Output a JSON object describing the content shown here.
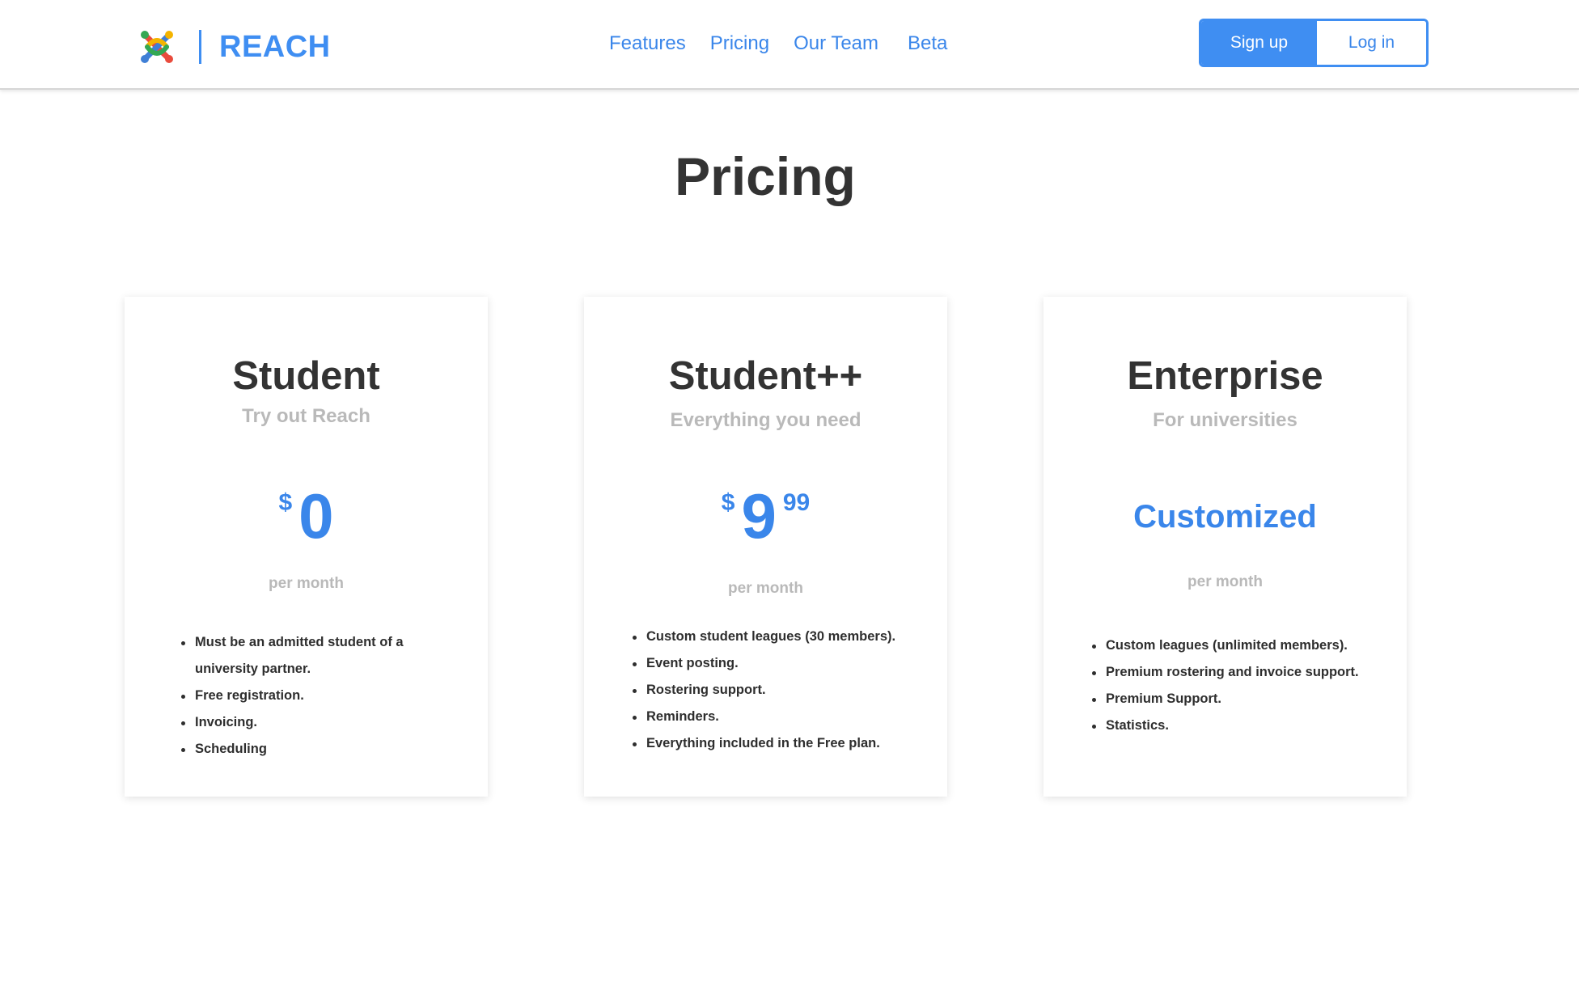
{
  "header": {
    "brand": "REACH",
    "nav": [
      "Features",
      "Pricing",
      "Our Team",
      "Beta"
    ],
    "signup_label": "Sign up",
    "login_label": "Log in"
  },
  "title": "Pricing",
  "plans": [
    {
      "name": "Student",
      "subtitle": "Try out Reach",
      "currency": "$",
      "amount": "0",
      "cents": "",
      "period": "per month",
      "features": [
        "Must be an admitted student of a university partner.",
        "Free registration.",
        "Invoicing.",
        "Scheduling"
      ]
    },
    {
      "name": "Student++",
      "subtitle": "Everything you need",
      "currency": "$",
      "amount": "9",
      "cents": "99",
      "period": "per month",
      "features": [
        "Custom student leagues (30 members).",
        "Event posting.",
        "Rostering support.",
        "Reminders.",
        "Everything included in the Free plan."
      ]
    },
    {
      "name": "Enterprise",
      "subtitle": "For universities",
      "price_text": "Customized",
      "period": "per month",
      "features": [
        "Custom leagues (unlimited members).",
        "Premium rostering and invoice support.",
        "Premium Support.",
        "Statistics."
      ]
    }
  ],
  "colors": {
    "accent": "#3f8ef2",
    "heading": "#333333",
    "muted": "#b9b9b9"
  },
  "icons": {
    "logo": "reach-logo-icon"
  }
}
